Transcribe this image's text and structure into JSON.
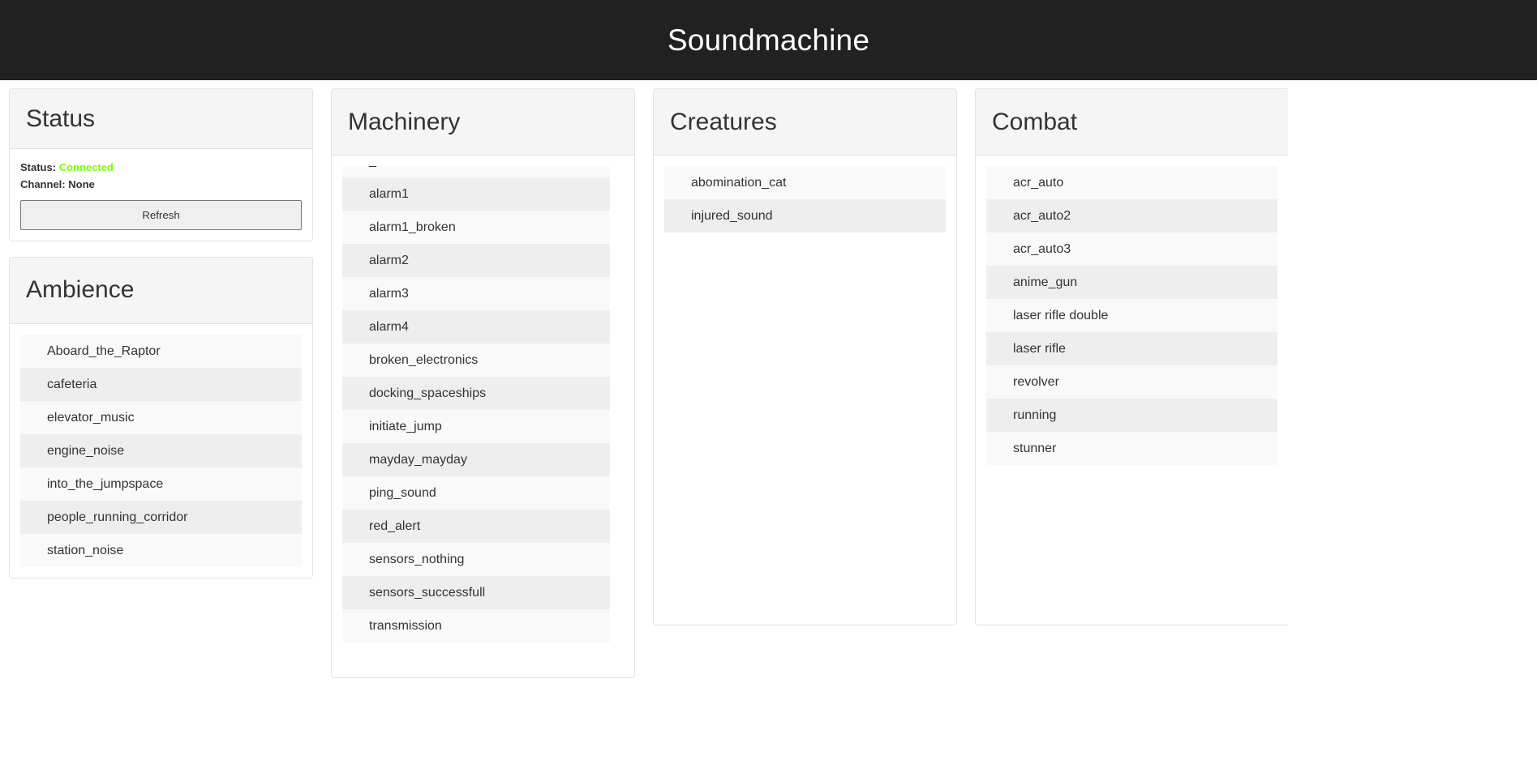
{
  "header": {
    "title": "Soundmachine"
  },
  "status_card": {
    "title": "Status",
    "status_label": "Status:",
    "status_value": "Connected",
    "status_color": "#7cfc00",
    "channel_label": "Channel:",
    "channel_value": "None",
    "refresh_label": "Refresh"
  },
  "ambience_card": {
    "title": "Ambience",
    "items": [
      "Aboard_the_Raptor",
      "cafeteria",
      "elevator_music",
      "engine_noise",
      "into_the_jumpspace",
      "people_running_corridor",
      "station_noise"
    ]
  },
  "machinery_card": {
    "title": "Machinery",
    "clipped_top_item": "_",
    "items": [
      "alarm1",
      "alarm1_broken",
      "alarm2",
      "alarm3",
      "alarm4",
      "broken_electronics",
      "docking_spaceships",
      "initiate_jump",
      "mayday_mayday",
      "ping_sound",
      "red_alert",
      "sensors_nothing",
      "sensors_successfull",
      "transmission"
    ],
    "scrollbar": {
      "up_arrow": "scroll-up",
      "down_arrow": "scroll-down"
    }
  },
  "creatures_card": {
    "title": "Creatures",
    "items": [
      "abomination_cat",
      "injured_sound"
    ]
  },
  "combat_card": {
    "title": "Combat",
    "items": [
      "acr_auto",
      "acr_auto2",
      "acr_auto3",
      "anime_gun",
      "laser rifle double",
      "laser rifle",
      "revolver",
      "running",
      "stunner"
    ]
  }
}
